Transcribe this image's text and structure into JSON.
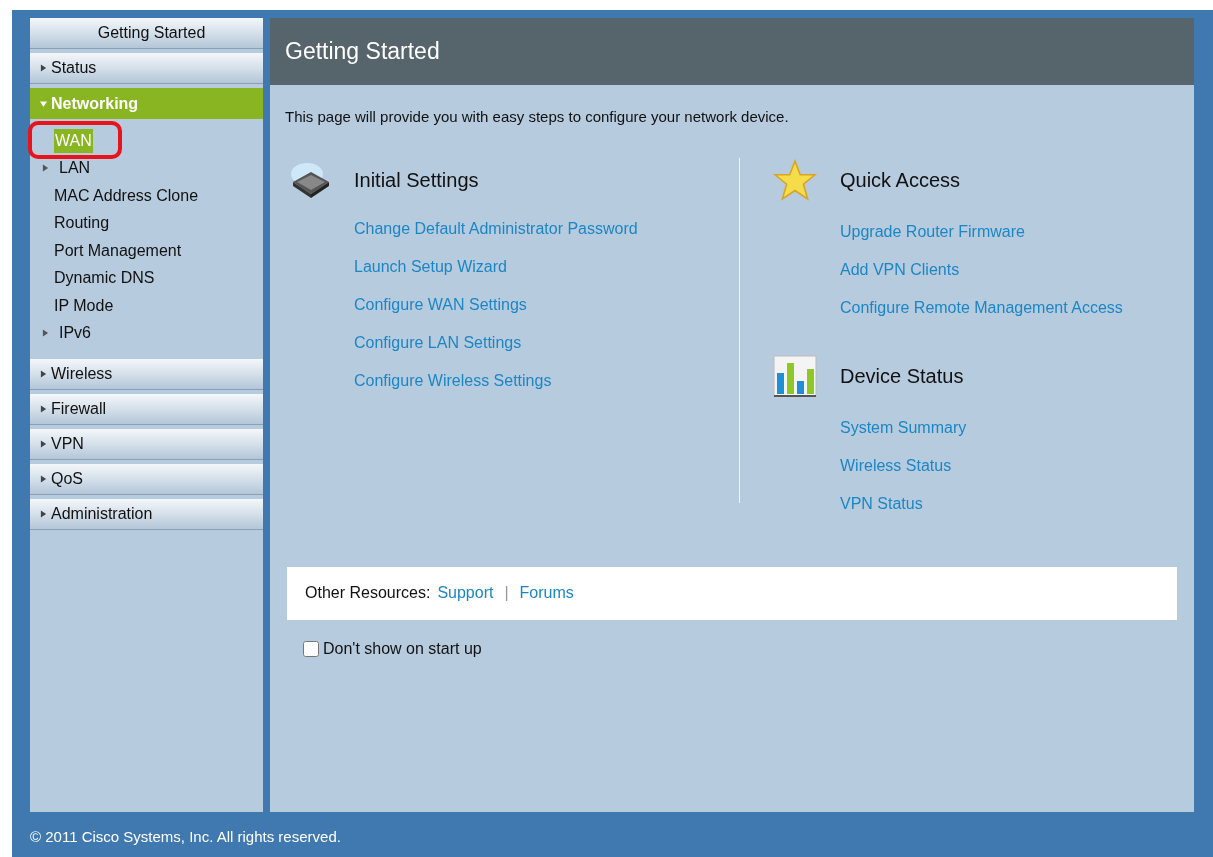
{
  "sidebar": {
    "items": [
      {
        "label": "Getting Started",
        "kind": "page",
        "selected": false
      },
      {
        "label": "Status",
        "kind": "section",
        "selected": false,
        "expanded": false
      },
      {
        "label": "Networking",
        "kind": "section",
        "selected": true,
        "expanded": true,
        "children": [
          {
            "label": "WAN",
            "kind": "page",
            "selected": true,
            "annotated": true
          },
          {
            "label": "LAN",
            "kind": "group",
            "selected": false
          },
          {
            "label": "MAC Address Clone",
            "kind": "page",
            "selected": false
          },
          {
            "label": "Routing",
            "kind": "page",
            "selected": false
          },
          {
            "label": "Port Management",
            "kind": "page",
            "selected": false
          },
          {
            "label": "Dynamic DNS",
            "kind": "page",
            "selected": false
          },
          {
            "label": "IP Mode",
            "kind": "page",
            "selected": false
          },
          {
            "label": "IPv6",
            "kind": "group",
            "selected": false
          }
        ]
      },
      {
        "label": "Wireless",
        "kind": "section",
        "selected": false,
        "expanded": false
      },
      {
        "label": "Firewall",
        "kind": "section",
        "selected": false,
        "expanded": false
      },
      {
        "label": "VPN",
        "kind": "section",
        "selected": false,
        "expanded": false
      },
      {
        "label": "QoS",
        "kind": "section",
        "selected": false,
        "expanded": false
      },
      {
        "label": "Administration",
        "kind": "section",
        "selected": false,
        "expanded": false
      }
    ]
  },
  "page": {
    "title": "Getting Started",
    "intro": "This page will provide you with easy steps to configure your network device.",
    "columns": [
      [
        {
          "title": "Initial Settings",
          "kind": "settings",
          "links": [
            "Change Default Administrator Password",
            "Launch Setup Wizard",
            "Configure WAN Settings",
            "Configure LAN Settings",
            "Configure Wireless Settings"
          ]
        }
      ],
      [
        {
          "title": "Quick Access",
          "kind": "favorites",
          "links": [
            "Upgrade Router Firmware",
            "Add VPN Clients",
            "Configure Remote Management Access"
          ]
        },
        {
          "title": "Device Status",
          "kind": "status",
          "links": [
            "System Summary",
            "Wireless Status",
            "VPN Status"
          ]
        }
      ]
    ],
    "resources": {
      "label": "Other Resources:",
      "links": [
        "Support",
        "Forums"
      ],
      "separator": "|"
    },
    "startup_checkbox": {
      "label": "Don't show on start up",
      "checked": false
    }
  },
  "footer": "© 2011 Cisco Systems, Inc. All rights reserved."
}
